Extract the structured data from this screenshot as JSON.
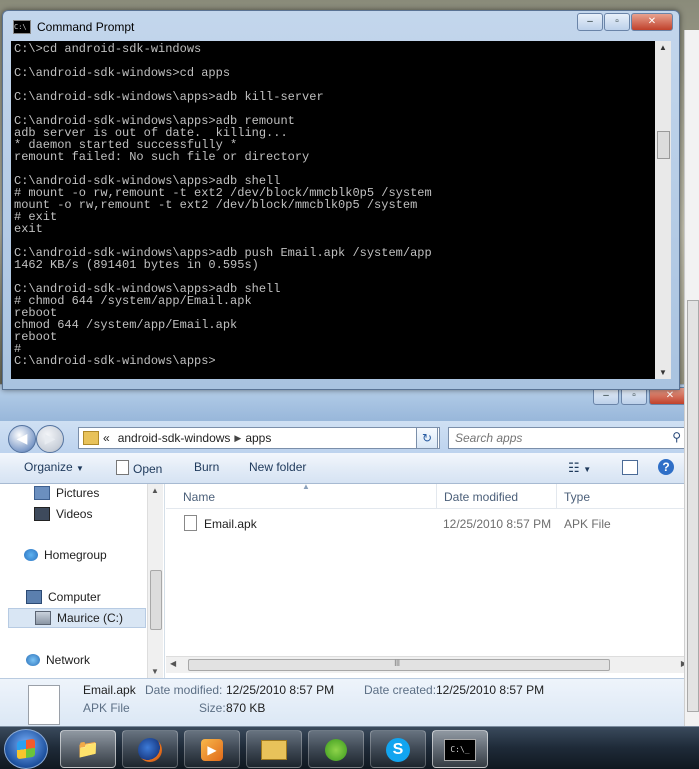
{
  "cmd": {
    "title": "Command Prompt",
    "console_text": "C:\\>cd android-sdk-windows\n\nC:\\android-sdk-windows>cd apps\n\nC:\\android-sdk-windows\\apps>adb kill-server\n\nC:\\android-sdk-windows\\apps>adb remount\nadb server is out of date.  killing...\n* daemon started successfully *\nremount failed: No such file or directory\n\nC:\\android-sdk-windows\\apps>adb shell\n# mount -o rw,remount -t ext2 /dev/block/mmcblk0p5 /system\nmount -o rw,remount -t ext2 /dev/block/mmcblk0p5 /system\n# exit\nexit\n\nC:\\android-sdk-windows\\apps>adb push Email.apk /system/app\n1462 KB/s (891401 bytes in 0.595s)\n\nC:\\android-sdk-windows\\apps>adb shell\n# chmod 644 /system/app/Email.apk\nreboot\nchmod 644 /system/app/Email.apk\nreboot\n#\nC:\\android-sdk-windows\\apps>"
  },
  "explorer": {
    "address": {
      "prefix": "«",
      "segments": [
        "android-sdk-windows",
        "apps"
      ]
    },
    "search_placeholder": "Search apps",
    "toolbar": {
      "organize": "Organize",
      "open": "Open",
      "burn": "Burn",
      "new_folder": "New folder"
    },
    "nav": {
      "pictures": "Pictures",
      "videos": "Videos",
      "homegroup": "Homegroup",
      "computer": "Computer",
      "drive": "Maurice (C:)",
      "network": "Network"
    },
    "columns": {
      "name": "Name",
      "date": "Date modified",
      "type": "Type"
    },
    "files": [
      {
        "name": "Email.apk",
        "date": "12/25/2010 8:57 PM",
        "type": "APK File"
      }
    ],
    "details": {
      "name": "Email.apk",
      "type": "APK File",
      "date_modified_label": "Date modified:",
      "date_modified": "12/25/2010 8:57 PM",
      "date_created_label": "Date created:",
      "date_created": "12/25/2010 8:57 PM",
      "size_label": "Size:",
      "size": "870 KB"
    }
  },
  "taskbar": {
    "buttons": [
      "file-explorer",
      "firefox",
      "media-player",
      "folder-pen",
      "messenger",
      "skype",
      "command-prompt"
    ]
  }
}
